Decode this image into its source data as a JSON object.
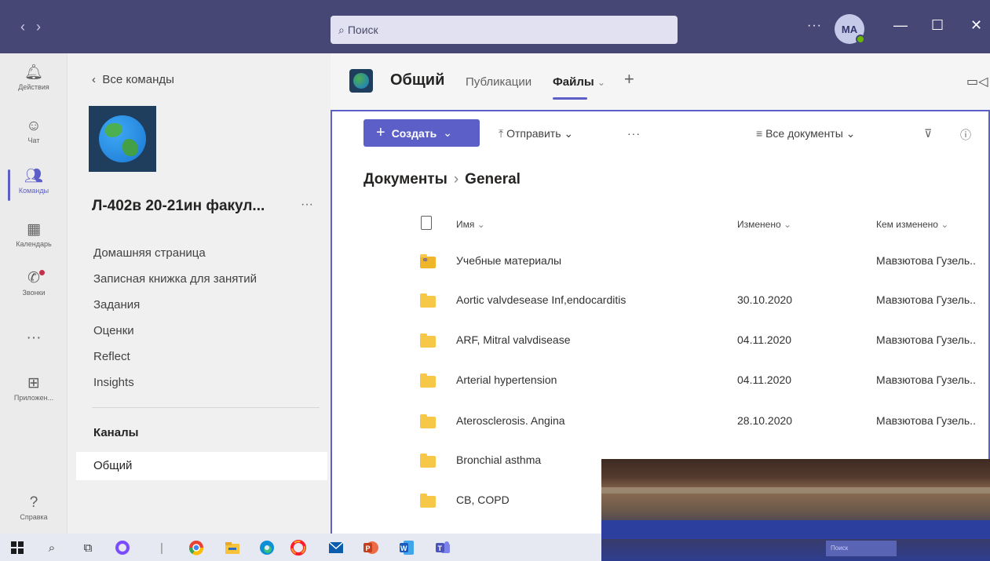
{
  "titlebar": {
    "back": "‹",
    "forward": "›",
    "search_placeholder": "Поиск",
    "more": "···",
    "avatar_initials": "MA",
    "minimize": "—",
    "maximize": "☐",
    "close": "✕"
  },
  "rail": [
    {
      "label": "Действия",
      "glyph": "🔔︎"
    },
    {
      "label": "Чат",
      "glyph": "☺"
    },
    {
      "label": "Команды",
      "glyph": "👥︎"
    },
    {
      "label": "Календарь",
      "glyph": "▦"
    },
    {
      "label": "Звонки",
      "glyph": "✆"
    },
    {
      "label": "",
      "glyph": "···"
    },
    {
      "label": "Приложен...",
      "glyph": "⊞"
    },
    {
      "label": "Справка",
      "glyph": "?"
    }
  ],
  "sidebar": {
    "back_label": "Все команды",
    "team_name": "Л-402в 20-21ин факул...",
    "team_more": "···",
    "links": [
      "Домашняя страница",
      "Записная книжка для занятий",
      "Задания",
      "Оценки",
      "Reflect",
      "Insights"
    ],
    "channels_header": "Каналы",
    "channel_selected": "Общий"
  },
  "header": {
    "channel_title": "Общий",
    "tabs": [
      "Публикации",
      "Файлы"
    ],
    "tab_chevron": "⌄",
    "add_tab": "+"
  },
  "toolbar": {
    "create_label": "Создать",
    "upload_label": "Отправить",
    "more": "···",
    "view_label": "Все документы"
  },
  "breadcrumb": {
    "root": "Документы",
    "current": "General"
  },
  "table": {
    "columns": [
      "Имя",
      "Изменено",
      "Кем изменено"
    ],
    "rows": [
      {
        "name": "Учебные материалы",
        "modified": "",
        "by": "Мавзютова Гузель..",
        "special": true
      },
      {
        "name": "Aortic valvdesease Inf,endocarditis",
        "modified": "30.10.2020",
        "by": "Мавзютова Гузель.."
      },
      {
        "name": "ARF, Mitral valvdisease",
        "modified": "04.11.2020",
        "by": "Мавзютова Гузель.."
      },
      {
        "name": "Arterial hypertension",
        "modified": "04.11.2020",
        "by": "Мавзютова Гузель.."
      },
      {
        "name": "Aterosclerosis. Angina",
        "modified": "28.10.2020",
        "by": "Мавзютова Гузель.."
      },
      {
        "name": "Bronchial asthma",
        "modified": "",
        "by": ""
      },
      {
        "name": "CB, COPD",
        "modified": "",
        "by": ""
      }
    ]
  },
  "overlay": {
    "mini_search": "Поиск"
  }
}
